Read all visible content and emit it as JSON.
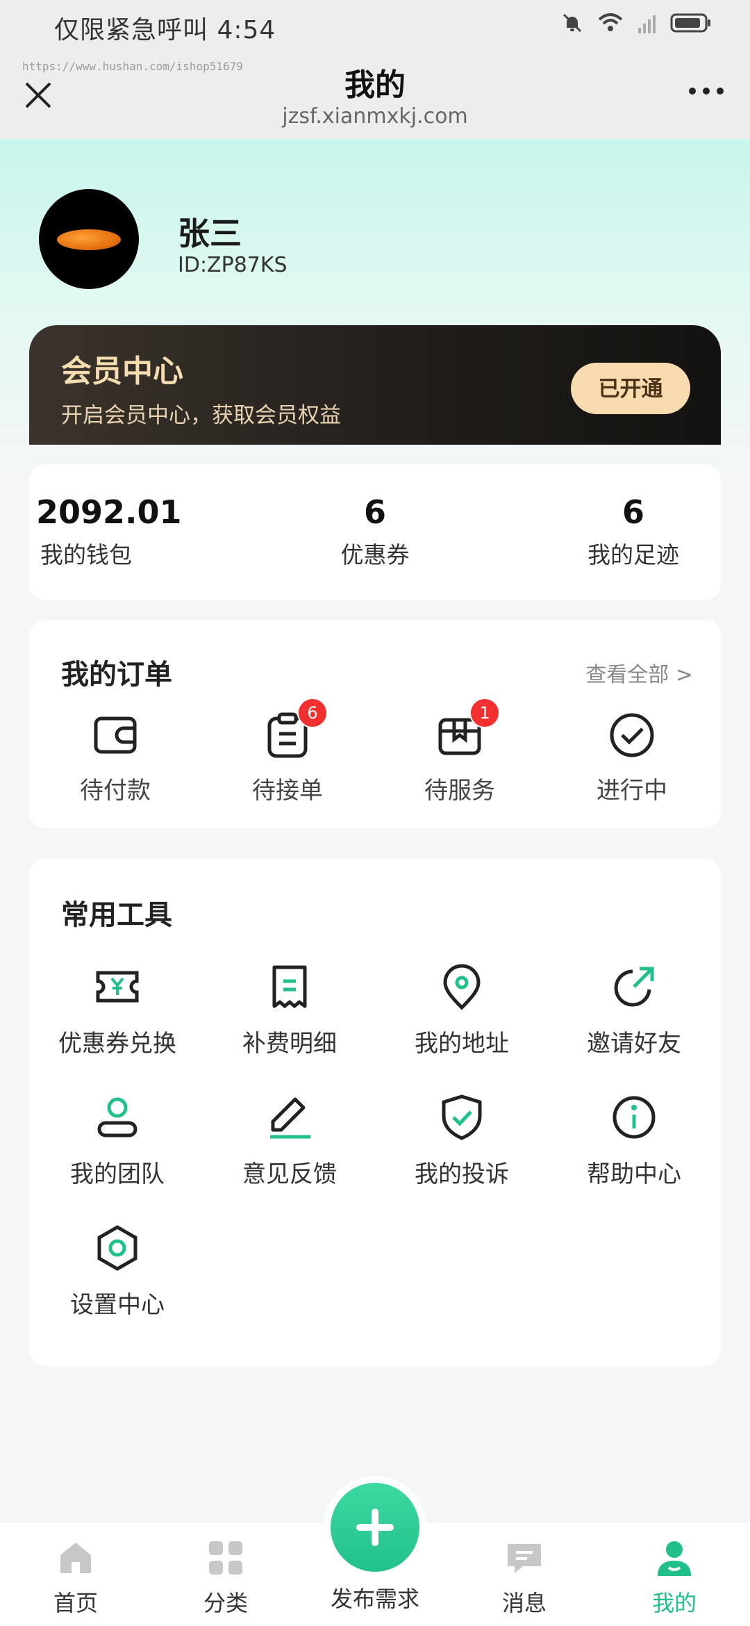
{
  "status_bar": {
    "text": "仅限紧急呼叫 4:54"
  },
  "watermark": "https://www.hushan.com/ishop51679",
  "title_bar": {
    "title": "我的",
    "url": "jzsf.xianmxkj.com"
  },
  "profile": {
    "name": "张三",
    "id": "ID:ZP87KS"
  },
  "vip": {
    "title": "会员中心",
    "subtitle": "开启会员中心，获取会员权益",
    "button": "已开通"
  },
  "stats": [
    {
      "value": "2092.01",
      "label": "我的钱包"
    },
    {
      "value": "6",
      "label": "优惠券"
    },
    {
      "value": "6",
      "label": "我的足迹"
    }
  ],
  "orders": {
    "title": "我的订单",
    "see_all": "查看全部 >",
    "items": [
      {
        "label": "待付款",
        "icon": "wallet-icon",
        "badge": ""
      },
      {
        "label": "待接单",
        "icon": "clipboard-icon",
        "badge": "6"
      },
      {
        "label": "待服务",
        "icon": "package-icon",
        "badge": "1"
      },
      {
        "label": "进行中",
        "icon": "check-circle-icon",
        "badge": ""
      }
    ]
  },
  "tools": {
    "title": "常用工具",
    "items": [
      {
        "label": "优惠券兑换",
        "icon": "coupon-icon"
      },
      {
        "label": "补费明细",
        "icon": "receipt-icon"
      },
      {
        "label": "我的地址",
        "icon": "location-icon"
      },
      {
        "label": "邀请好友",
        "icon": "share-icon"
      },
      {
        "label": "我的团队",
        "icon": "team-icon"
      },
      {
        "label": "意见反馈",
        "icon": "edit-icon"
      },
      {
        "label": "我的投诉",
        "icon": "shield-check-icon"
      },
      {
        "label": "帮助中心",
        "icon": "info-icon"
      },
      {
        "label": "设置中心",
        "icon": "settings-icon"
      }
    ]
  },
  "tabbar": {
    "items": [
      {
        "label": "首页",
        "icon": "home-icon"
      },
      {
        "label": "分类",
        "icon": "grid-icon"
      },
      {
        "label": "发布需求",
        "icon": "plus-icon"
      },
      {
        "label": "消息",
        "icon": "message-icon"
      },
      {
        "label": "我的",
        "icon": "profile-icon"
      }
    ],
    "active_index": 4
  },
  "colors": {
    "accent": "#21c08b",
    "badge": "#f23030",
    "vip_gold": "#f6dcb1"
  }
}
